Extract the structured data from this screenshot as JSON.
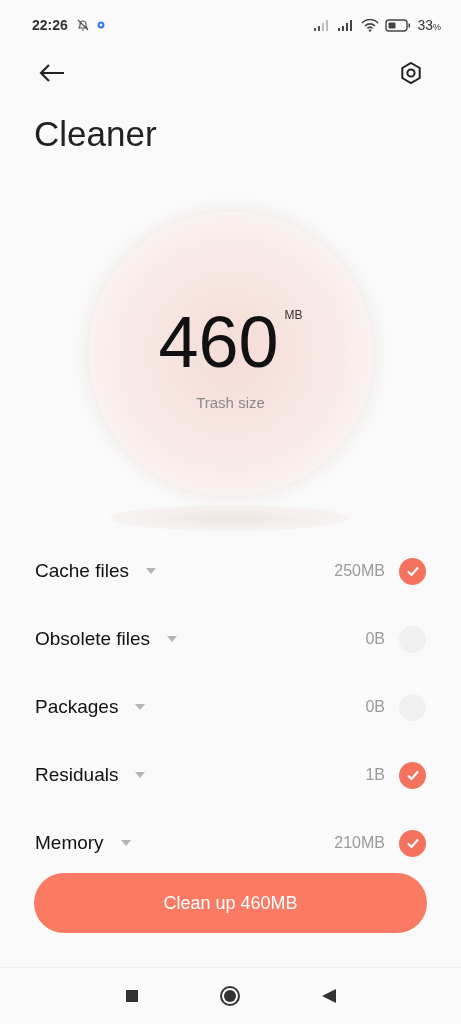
{
  "status_bar": {
    "time": "22:26",
    "battery": "33",
    "battery_unit": "%"
  },
  "title": "Cleaner",
  "summary": {
    "value": "460",
    "unit": "MB",
    "caption": "Trash size"
  },
  "items": [
    {
      "name": "Cache files",
      "size": "250MB",
      "checked": true
    },
    {
      "name": "Obsolete files",
      "size": "0B",
      "checked": false
    },
    {
      "name": "Packages",
      "size": "0B",
      "checked": false
    },
    {
      "name": "Residuals",
      "size": "1B",
      "checked": true
    },
    {
      "name": "Memory",
      "size": "210MB",
      "checked": true
    }
  ],
  "action": {
    "label": "Clean up 460MB"
  }
}
